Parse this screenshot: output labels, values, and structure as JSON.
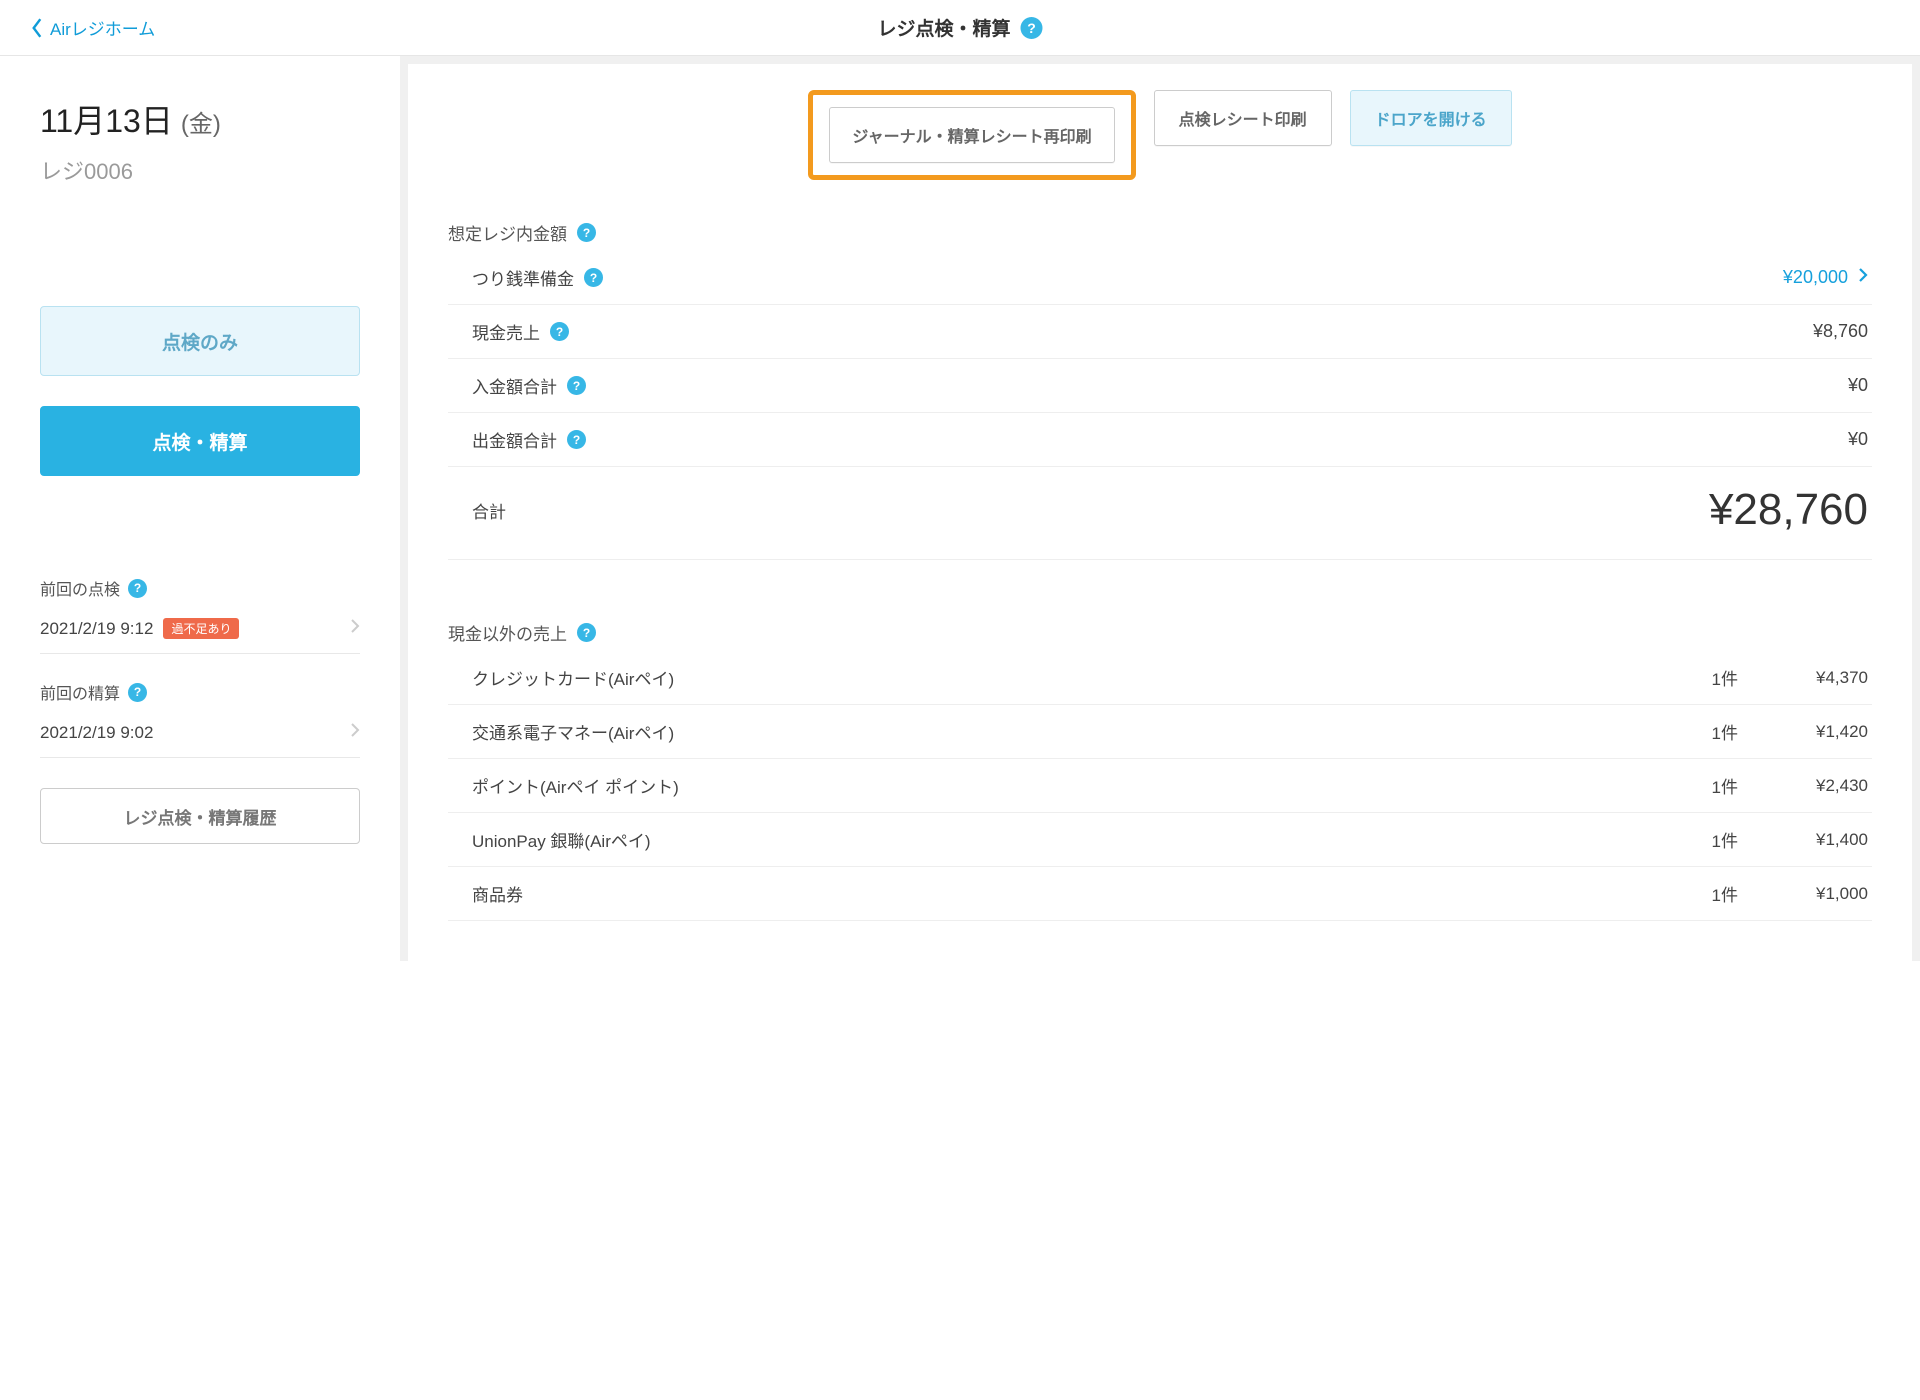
{
  "header": {
    "back_label": "Airレジホーム",
    "title": "レジ点検・精算"
  },
  "sidebar": {
    "date_main": "11月13日",
    "date_dow": "(金)",
    "register": "レジ0006",
    "inspect_btn": "点検のみ",
    "settle_btn": "点検・精算",
    "prev_inspect_label": "前回の点検",
    "prev_inspect_time": "2021/2/19 9:12",
    "prev_inspect_badge": "過不足あり",
    "prev_settle_label": "前回の精算",
    "prev_settle_time": "2021/2/19 9:02",
    "history_btn": "レジ点検・精算履歴"
  },
  "toolbar": {
    "reprint": "ジャーナル・精算レシート再印刷",
    "inspect_print": "点検レシート印刷",
    "open_drawer": "ドロアを開ける"
  },
  "expected": {
    "section_label": "想定レジ内金額",
    "rows": {
      "change_fund": {
        "label": "つり銭準備金",
        "value": "¥20,000"
      },
      "cash_sales": {
        "label": "現金売上",
        "value": "¥8,760"
      },
      "deposits": {
        "label": "入金額合計",
        "value": "¥0"
      },
      "withdraw": {
        "label": "出金額合計",
        "value": "¥0"
      }
    },
    "total_label": "合計",
    "total_value": "¥28,760"
  },
  "noncash": {
    "section_label": "現金以外の売上",
    "rows": [
      {
        "name": "クレジットカード(Airペイ)",
        "count": "1件",
        "amount": "¥4,370"
      },
      {
        "name": "交通系電子マネー(Airペイ)",
        "count": "1件",
        "amount": "¥1,420"
      },
      {
        "name": "ポイント(Airペイ ポイント)",
        "count": "1件",
        "amount": "¥2,430"
      },
      {
        "name": "UnionPay 銀聯(Airペイ)",
        "count": "1件",
        "amount": "¥1,400"
      },
      {
        "name": "商品券",
        "count": "1件",
        "amount": "¥1,000"
      }
    ]
  }
}
